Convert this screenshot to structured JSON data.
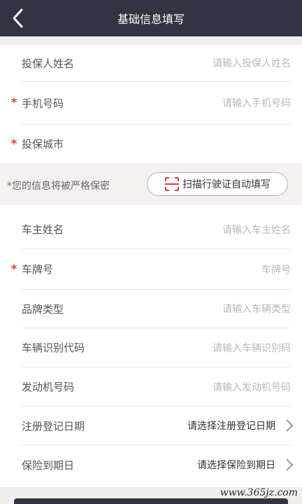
{
  "header": {
    "title": "基础信息填写"
  },
  "insured": {
    "name_label": "投保人姓名",
    "name_placeholder": "请输入投保人姓名",
    "phone_label": "手机号码",
    "phone_placeholder": "请输入手机号码",
    "city_label": "投保城市",
    "required_mark": "*"
  },
  "notice": {
    "text": "*您的信息将被严格保密",
    "scan_button": "扫描行驶证自动填写"
  },
  "vehicle": {
    "owner_label": "车主姓名",
    "owner_placeholder": "请输入车主姓名",
    "plate_label": "车牌号",
    "plate_placeholder": "车牌号",
    "brand_label": "品牌类型",
    "brand_placeholder": "请输入车辆类型",
    "vin_label": "车辆识别代码",
    "vin_placeholder": "请输入车辆识别码",
    "engine_label": "发动机号码",
    "engine_placeholder": "请输入发动机号码",
    "reg_date_label": "注册登记日期",
    "reg_date_value": "请选择注册登记日期",
    "expiry_label": "保险到期日",
    "expiry_value": "请选择保险到期日"
  },
  "watermark": "www.365jz.com",
  "icons": {
    "back": "chevron-left-icon",
    "scan": "scan-frame-icon",
    "chevron": "chevron-right-icon"
  },
  "colors": {
    "header_bg": "#2f3542",
    "required": "#e03e3e",
    "scan_icon": "#e03e3e"
  }
}
